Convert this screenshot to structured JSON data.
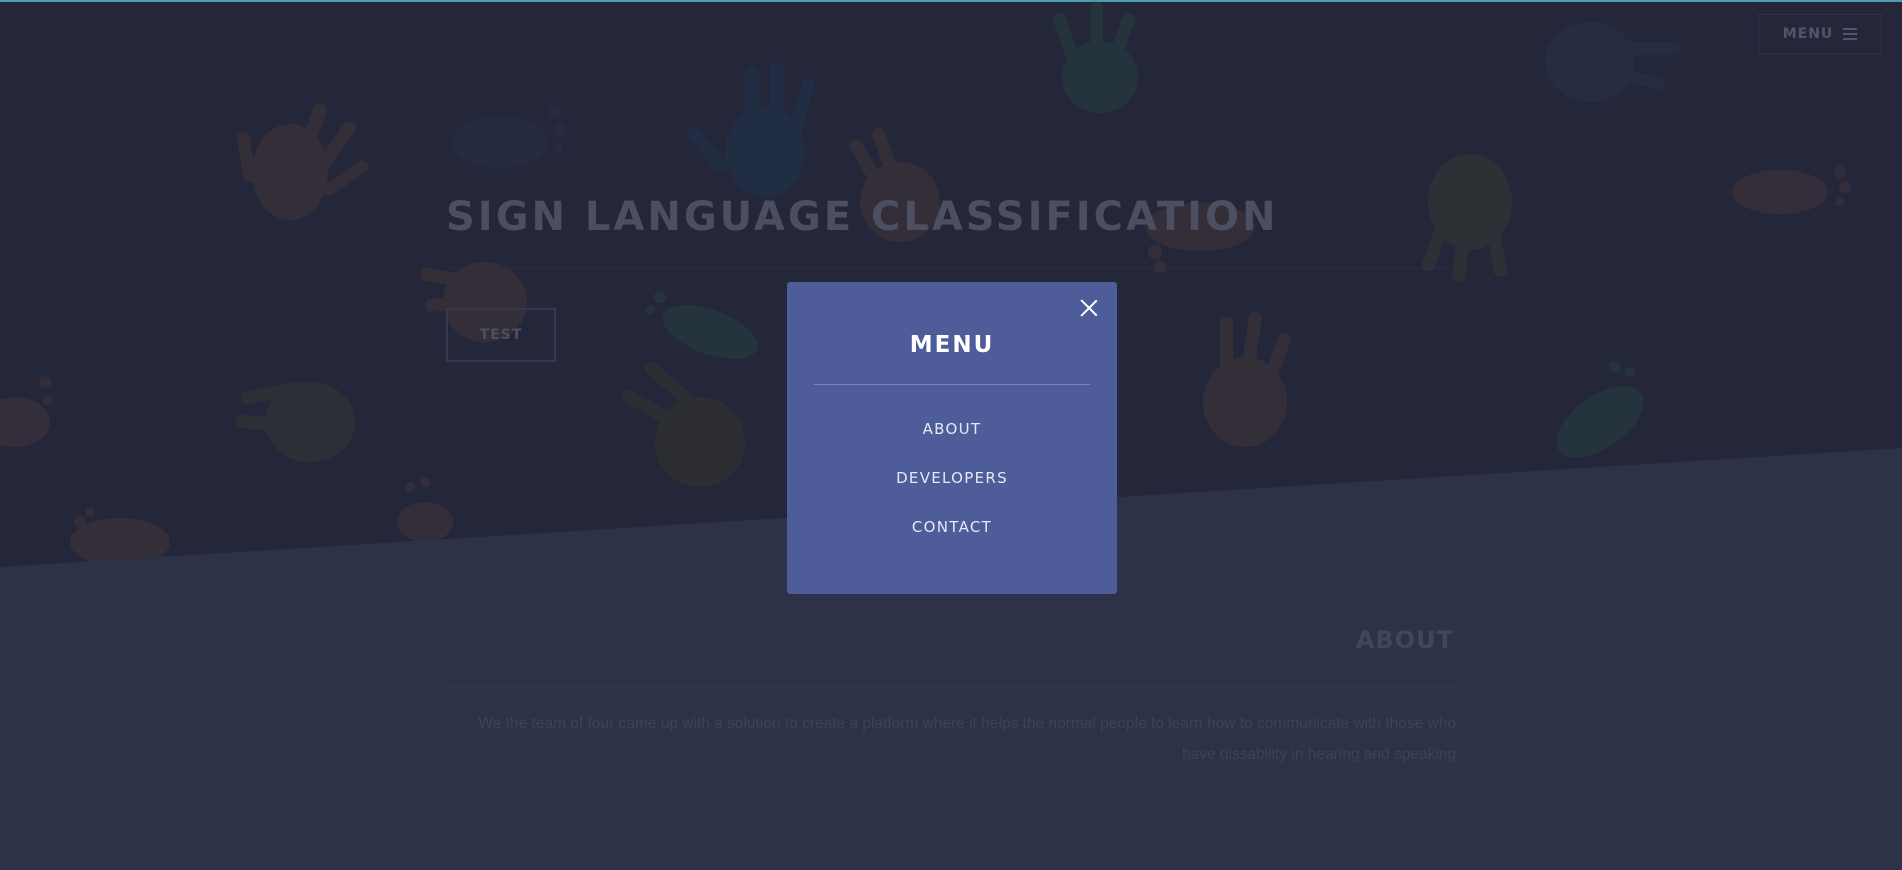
{
  "nav": {
    "menu_label": "MENU"
  },
  "hero": {
    "title": "SIGN LANGUAGE CLASSIFICATION",
    "test_button_label": "TEST"
  },
  "about": {
    "heading": "ABOUT",
    "text": "We the team of four came up with a solution to create a platform where it helps the normal people to learn how to communicate with those who have dissability in hearing and speaking"
  },
  "modal": {
    "title": "MENU",
    "items": [
      {
        "label": "ABOUT"
      },
      {
        "label": "DEVELOPERS"
      },
      {
        "label": "CONTACT"
      }
    ]
  },
  "colors": {
    "hero_background": "#272a3d",
    "about_background": "#33364f",
    "modal_background": "#4e5d9a",
    "accent_top_border": "#4c9bb0"
  }
}
